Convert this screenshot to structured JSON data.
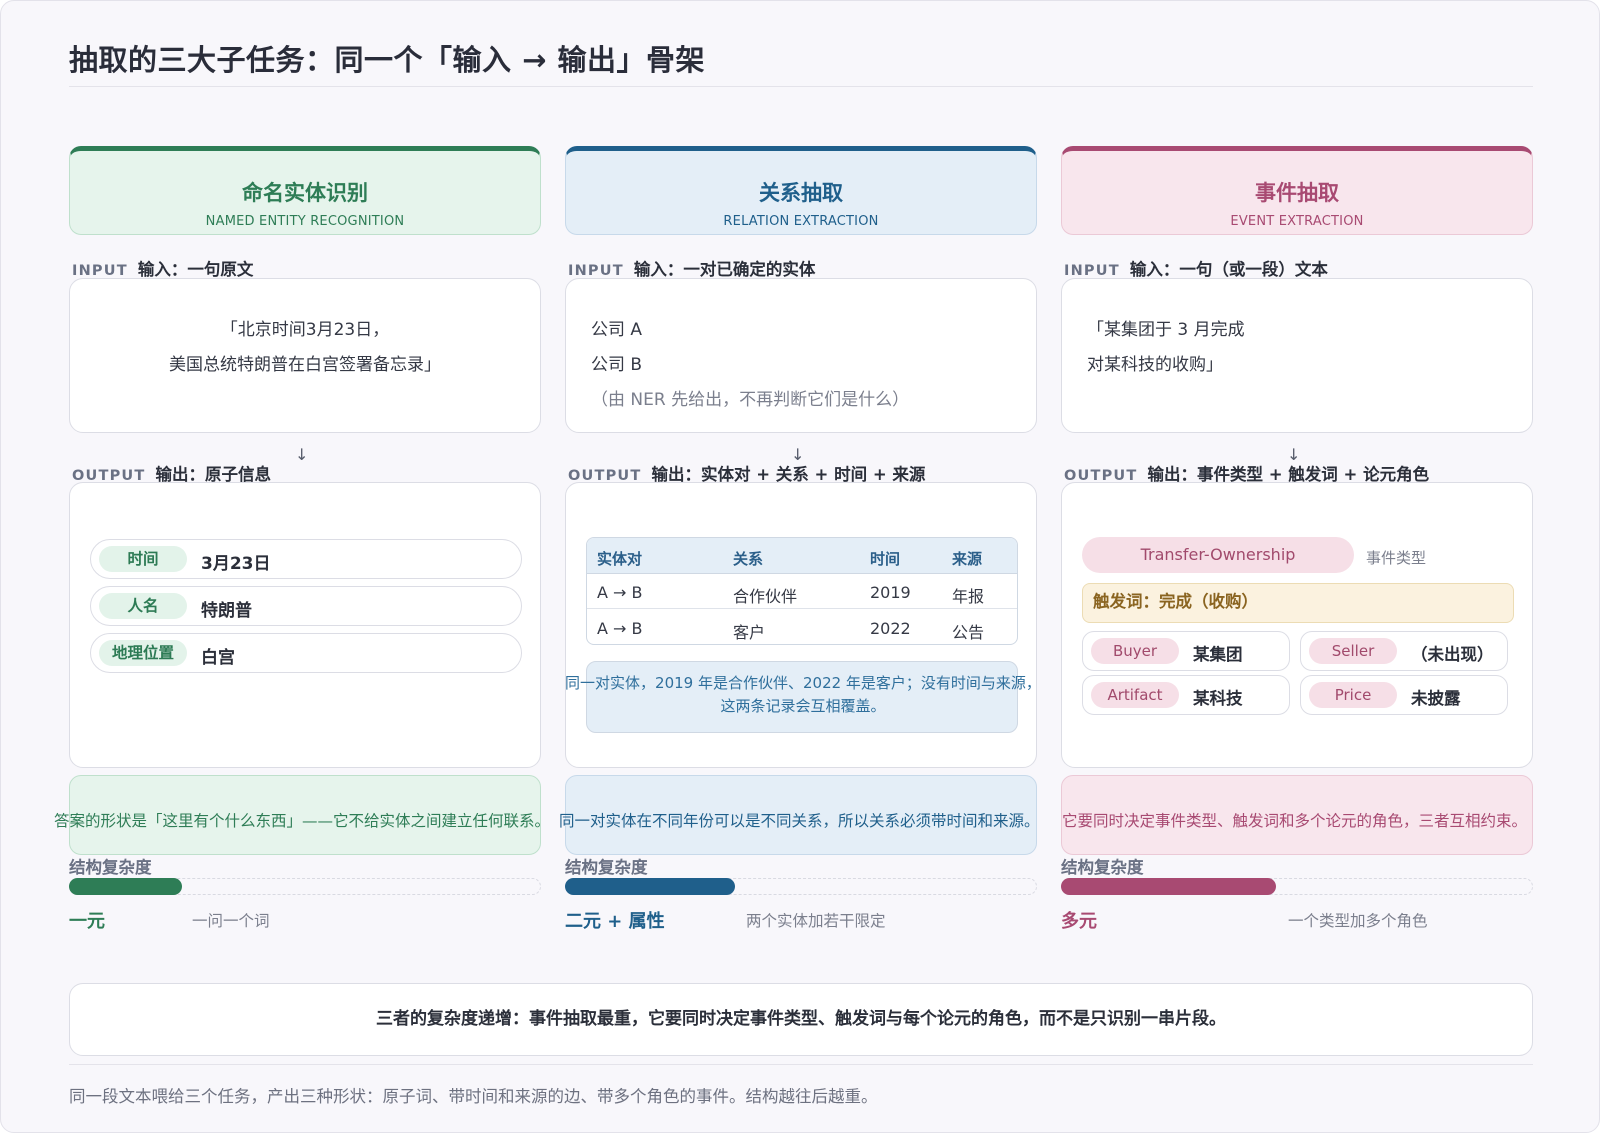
{
  "title": "抽取的三大子任务：同一个「输入 → 输出」骨架",
  "colors": {
    "ner": "#2e7d56",
    "re": "#1f5f8b",
    "event": "#a84a72",
    "trigger": "#8a6420"
  },
  "arrow": "↓",
  "columns": [
    {
      "title_zh": "命名实体识别",
      "title_en": "NAMED ENTITY RECOGNITION",
      "input_tag": "INPUT",
      "input_label": "输入：一句原文",
      "input_lines": [
        "「北京时间3月23日，",
        "美国总统特朗普在白宫签署备忘录」"
      ],
      "output_tag": "OUTPUT",
      "output_label": "输出：原子信息",
      "entities": [
        {
          "type": "时间",
          "value": "3月23日"
        },
        {
          "type": "人名",
          "value": "特朗普"
        },
        {
          "type": "地理位置",
          "value": "白宫"
        }
      ],
      "caption": "答案的形状是「这里有个什么东西」——它不给实体之间建立任何联系。",
      "complexity_label": "结构复杂度",
      "complexity_fraction": 0.24,
      "complexity_level": "一元",
      "complexity_desc": "一问一个词"
    },
    {
      "title_zh": "关系抽取",
      "title_en": "RELATION EXTRACTION",
      "input_tag": "INPUT",
      "input_label": "输入：一对已确定的实体",
      "input_lines": [
        "公司 A",
        "公司 B",
        "（由 NER 先给出，不再判断它们是什么）"
      ],
      "output_tag": "OUTPUT",
      "output_label": "输出：实体对 + 关系 + 时间 + 来源",
      "table": {
        "headers": [
          "实体对",
          "关系",
          "时间",
          "来源"
        ],
        "rows": [
          [
            "A → B",
            "合作伙伴",
            "2019",
            "年报"
          ],
          [
            "A → B",
            "客户",
            "2022",
            "公告"
          ]
        ]
      },
      "note_lines": [
        "同一对实体，2019 年是合作伙伴、2022 年是客户；没有时间与来源，",
        "这两条记录会互相覆盖。"
      ],
      "caption": "同一对实体在不同年份可以是不同关系，所以关系必须带时间和来源。",
      "complexity_label": "结构复杂度",
      "complexity_fraction": 0.36,
      "complexity_level": "二元 + 属性",
      "complexity_desc": "两个实体加若干限定"
    },
    {
      "title_zh": "事件抽取",
      "title_en": "EVENT EXTRACTION",
      "input_tag": "INPUT",
      "input_label": "输入：一句（或一段）文本",
      "input_lines": [
        "「某集团于 3 月完成",
        "对某科技的收购」"
      ],
      "output_tag": "OUTPUT",
      "output_label": "输出：事件类型 + 触发词 + 论元角色",
      "event_type": "Transfer-Ownership",
      "event_type_label": "事件类型",
      "trigger": "触发词：完成（收购）",
      "roles": [
        {
          "role": "Buyer",
          "value": "某集团"
        },
        {
          "role": "Seller",
          "value": "（未出现）"
        },
        {
          "role": "Artifact",
          "value": "某科技"
        },
        {
          "role": "Price",
          "value": "未披露"
        }
      ],
      "caption": "它要同时决定事件类型、触发词和多个论元的角色，三者互相约束。",
      "complexity_label": "结构复杂度",
      "complexity_fraction": 0.455,
      "complexity_level": "多元",
      "complexity_desc": "一个类型加多个角色"
    }
  ],
  "summary": "三者的复杂度递增：事件抽取最重，它要同时决定事件类型、触发词与每个论元的角色，而不是只识别一串片段。",
  "footer": "同一段文本喂给三个任务，产出三种形状：原子词、带时间和来源的边、带多个角色的事件。结构越往后越重。"
}
